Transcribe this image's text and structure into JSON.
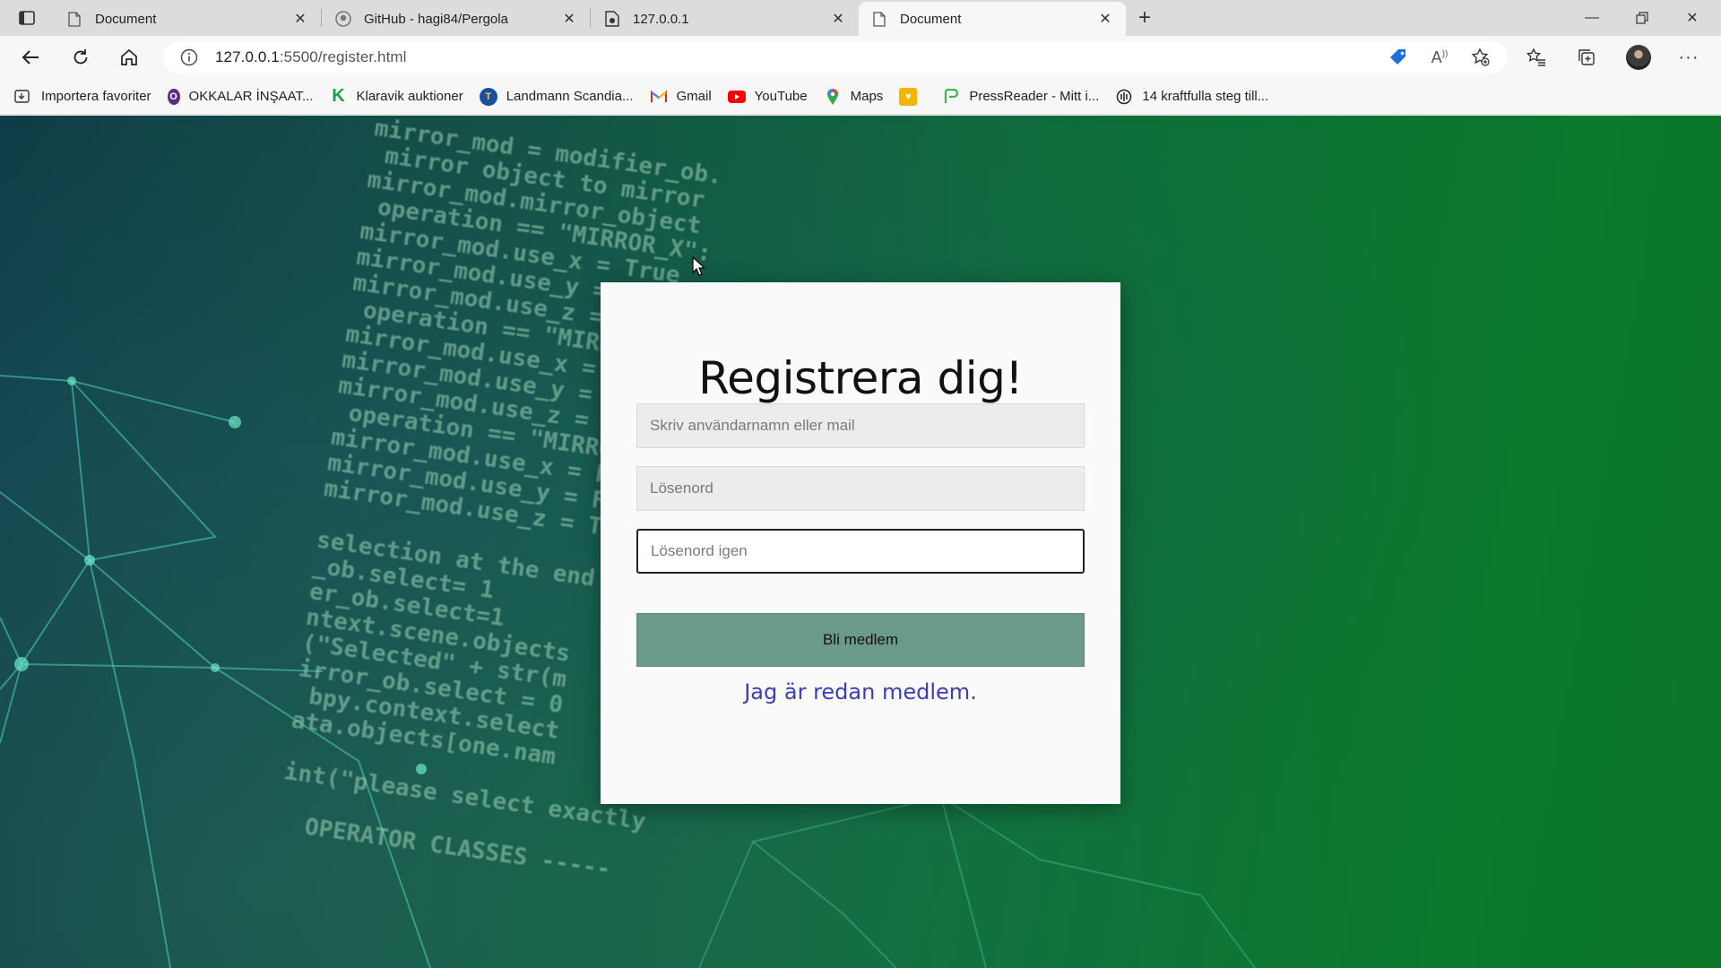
{
  "browser": {
    "tabs": [
      {
        "title": "Document",
        "favicon": "page-icon",
        "active": false
      },
      {
        "title": "GitHub - hagi84/Pergola",
        "favicon": "github-icon",
        "active": false
      },
      {
        "title": "127.0.0.1",
        "favicon": "live-server-icon",
        "active": false
      },
      {
        "title": "Document",
        "favicon": "page-icon",
        "active": true
      }
    ],
    "url_host": "127.0.0.1",
    "url_path": ":5500/register.html",
    "favorites": [
      {
        "label": "Importera favoriter",
        "icon": "import-icon"
      },
      {
        "label": "OKKALAR İNŞAAT...",
        "icon": "okkalar-icon"
      },
      {
        "label": "Klaravik auktioner",
        "icon": "klaravik-icon"
      },
      {
        "label": "Landmann Scandia...",
        "icon": "landmann-icon"
      },
      {
        "label": "Gmail",
        "icon": "gmail-icon"
      },
      {
        "label": "YouTube",
        "icon": "youtube-icon"
      },
      {
        "label": "Maps",
        "icon": "maps-icon"
      },
      {
        "label": "",
        "icon": "bookmark-orange-icon"
      },
      {
        "label": "PressReader - Mitt i...",
        "icon": "pressreader-icon"
      },
      {
        "label": "14 kraftfulla steg till...",
        "icon": "podcast-icon"
      }
    ]
  },
  "page": {
    "heading": "Registrera dig!",
    "username_placeholder": "Skriv användarnamn eller mail",
    "password_placeholder": "Lösenord",
    "password_repeat_placeholder": "Lösenord igen",
    "submit_label": "Bli medlem",
    "login_link": "Jag är redan medlem."
  },
  "colors": {
    "button_bg": "#6b9a8c",
    "link": "#3d3db5",
    "bg_left": "#0f3b45",
    "bg_right": "#0b7528"
  }
}
